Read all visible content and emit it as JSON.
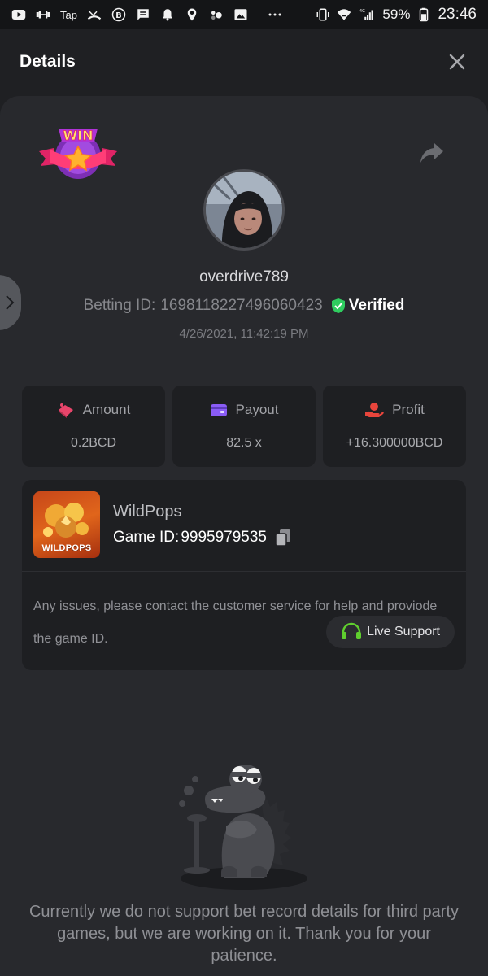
{
  "status_bar": {
    "left_icons": [
      "youtube-icon",
      "dumbbell-icon",
      "tap-icon",
      "missed-call-icon",
      "bitcoin-icon",
      "message-icon",
      "bell-icon",
      "location-icon",
      "dots-icon",
      "image-icon",
      "more-icon"
    ],
    "tap_label": "Tap",
    "network": "4G",
    "battery": "59%",
    "time": "23:46"
  },
  "header": {
    "title": "Details"
  },
  "profile": {
    "username": "overdrive789",
    "betting_id_label": "Betting ID:",
    "betting_id": "1698118227496060423",
    "verified_label": "Verified",
    "datetime": "4/26/2021, 11:42:19 PM",
    "badge_text": "WIN"
  },
  "stats": [
    {
      "label": "Amount",
      "value": "0.2BCD",
      "icon": "amount-icon",
      "color": "#e8456b"
    },
    {
      "label": "Payout",
      "value": "82.5 x",
      "icon": "wallet-icon",
      "color": "#8a5cf6"
    },
    {
      "label": "Profit",
      "value": "+16.300000BCD",
      "icon": "profit-hand-icon",
      "color": "#e8453c"
    }
  ],
  "game": {
    "name": "WildPops",
    "thumb_label": "WILDPOPS",
    "id_label": "Game ID:",
    "id": "9995979535",
    "issue_text": "Any issues, please contact the customer service for help and proviode the game ID.",
    "support_label": "Live Support"
  },
  "notice": "Currently we do not support bet record details for third party games, but we are working on it. Thank you for your patience.",
  "colors": {
    "background": "#1f2023",
    "card": "#28292d",
    "verified_green": "#2fcd5f",
    "support_green": "#5fce2e"
  }
}
